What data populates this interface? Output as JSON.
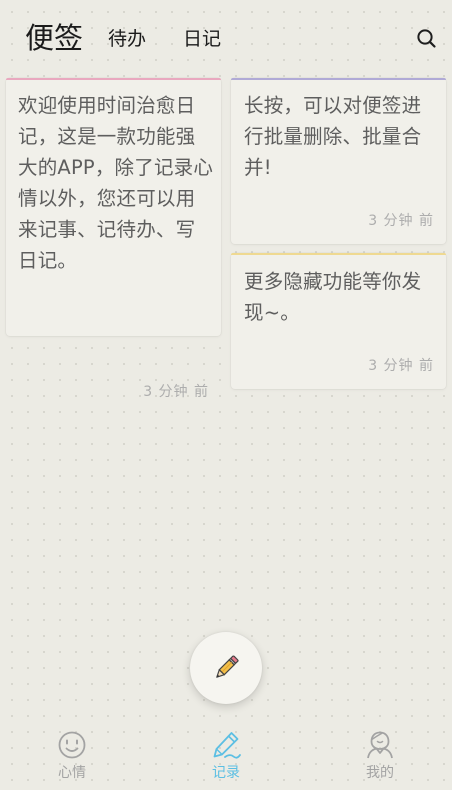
{
  "header": {
    "tabs": [
      {
        "label": "便签",
        "active": true
      },
      {
        "label": "待办",
        "active": false
      },
      {
        "label": "日记",
        "active": false
      }
    ],
    "search_icon": "search-icon"
  },
  "notes": [
    {
      "text": "欢迎使用时间治愈日记，这是一款功能强大的APP，除了记录心情以外，您还可以用来记事、记待办、写日记。",
      "time": "3 分钟 前",
      "accent_color": "#e9a8bf"
    },
    {
      "text": "长按，可以对便签进行批量删除、批量合并!",
      "time": "3 分钟 前",
      "accent_color": "#b0aad6"
    },
    {
      "text": "更多隐藏功能等你发现~。",
      "time": "3 分钟 前",
      "accent_color": "#efd991"
    }
  ],
  "fab": {
    "icon": "pencil-icon"
  },
  "bottom_nav": {
    "items": [
      {
        "label": "心情",
        "icon": "smiley-icon",
        "active": false
      },
      {
        "label": "记录",
        "icon": "pen-icon",
        "active": true
      },
      {
        "label": "我的",
        "icon": "profile-icon",
        "active": false
      }
    ]
  },
  "colors": {
    "background": "#ecebe4",
    "card": "#f1f0ea",
    "nav_active": "#5cbfe3",
    "nav_inactive": "#a3a3a3"
  }
}
